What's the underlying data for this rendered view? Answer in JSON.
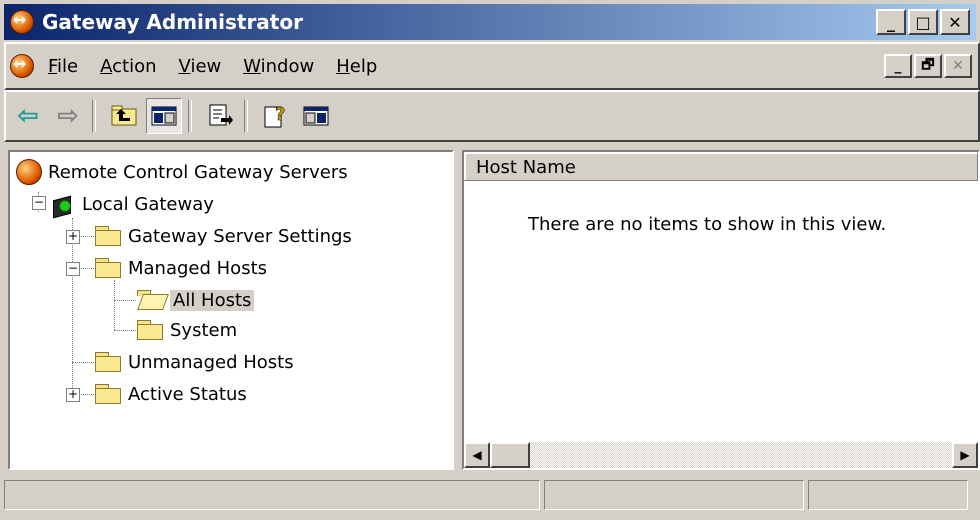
{
  "window": {
    "title": "Gateway Administrator"
  },
  "caption_buttons": [
    "_",
    "□",
    "✕"
  ],
  "menu": [
    {
      "prefix": "",
      "ul": "F",
      "rest": "ile"
    },
    {
      "prefix": "",
      "ul": "A",
      "rest": "ction"
    },
    {
      "prefix": "",
      "ul": "V",
      "rest": "iew"
    },
    {
      "prefix": "",
      "ul": "W",
      "rest": "indow"
    },
    {
      "prefix": "",
      "ul": "H",
      "rest": "elp"
    }
  ],
  "mdi_buttons": [
    "_",
    "🗗",
    "✕"
  ],
  "toolbar": {
    "icons": [
      "back-arrow-icon",
      "forward-arrow-icon",
      "up-one-level-icon",
      "show-hide-console-tree-icon",
      "export-list-icon",
      "help-icon",
      "show-hide-action-pane-icon"
    ]
  },
  "tree": {
    "root": "Remote Control Gateway Servers",
    "local_gateway": "Local Gateway",
    "gateway_server_settings": "Gateway Server Settings",
    "managed_hosts": "Managed Hosts",
    "all_hosts": "All Hosts",
    "system": "System",
    "unmanaged_hosts": "Unmanaged Hosts",
    "active_status": "Active Status"
  },
  "list": {
    "column_header": "Host Name",
    "empty_message": "There are no items to show in this view."
  },
  "colors": {
    "titlebar_start": "#0a246a",
    "titlebar_end": "#a6caf0",
    "face": "#d4d0c8"
  }
}
